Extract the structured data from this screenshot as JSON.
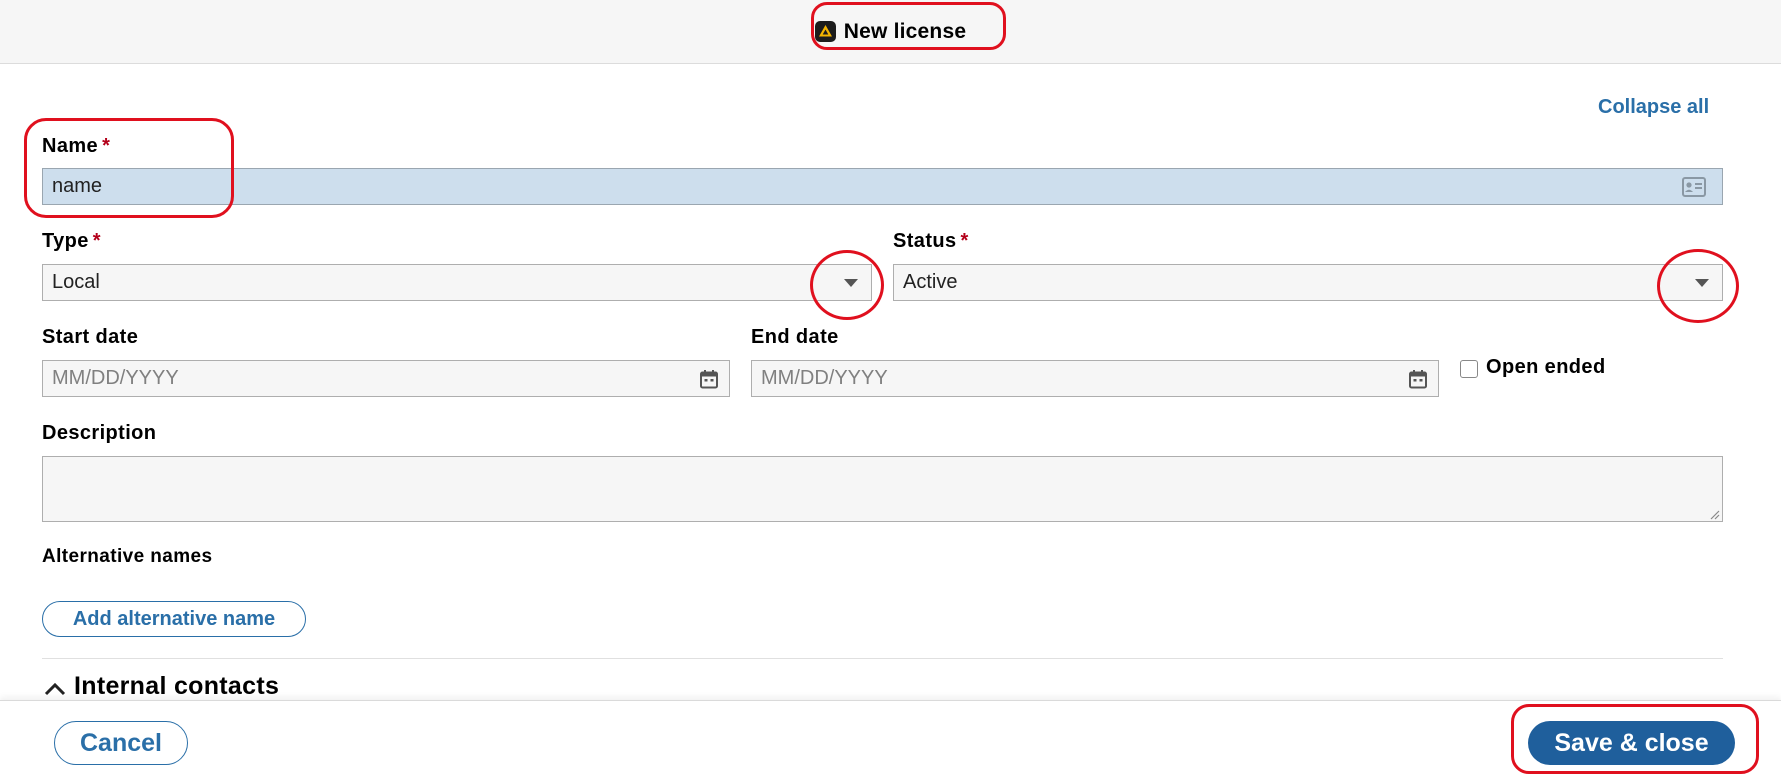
{
  "header": {
    "title": "New license",
    "icon": "app-logo-icon"
  },
  "actions": {
    "collapse_all": "Collapse all"
  },
  "form": {
    "name": {
      "label": "Name",
      "required_mark": "*",
      "value": "name"
    },
    "type": {
      "label": "Type",
      "required_mark": "*",
      "value": "Local"
    },
    "status": {
      "label": "Status",
      "required_mark": "*",
      "value": "Active"
    },
    "start_date": {
      "label": "Start date",
      "placeholder": "MM/DD/YYYY"
    },
    "end_date": {
      "label": "End date",
      "placeholder": "MM/DD/YYYY"
    },
    "open_ended": {
      "label": "Open ended",
      "checked": false
    },
    "description": {
      "label": "Description",
      "value": ""
    },
    "alternative_names": {
      "label": "Alternative names",
      "add_button": "Add alternative name"
    }
  },
  "sections": {
    "internal_contacts": "Internal contacts"
  },
  "footer": {
    "cancel": "Cancel",
    "save_close": "Save & close"
  },
  "colors": {
    "accent": "#2a6fa8",
    "primary_button": "#1f5f9c",
    "required": "#b3001a",
    "annotation": "#e0101e"
  }
}
